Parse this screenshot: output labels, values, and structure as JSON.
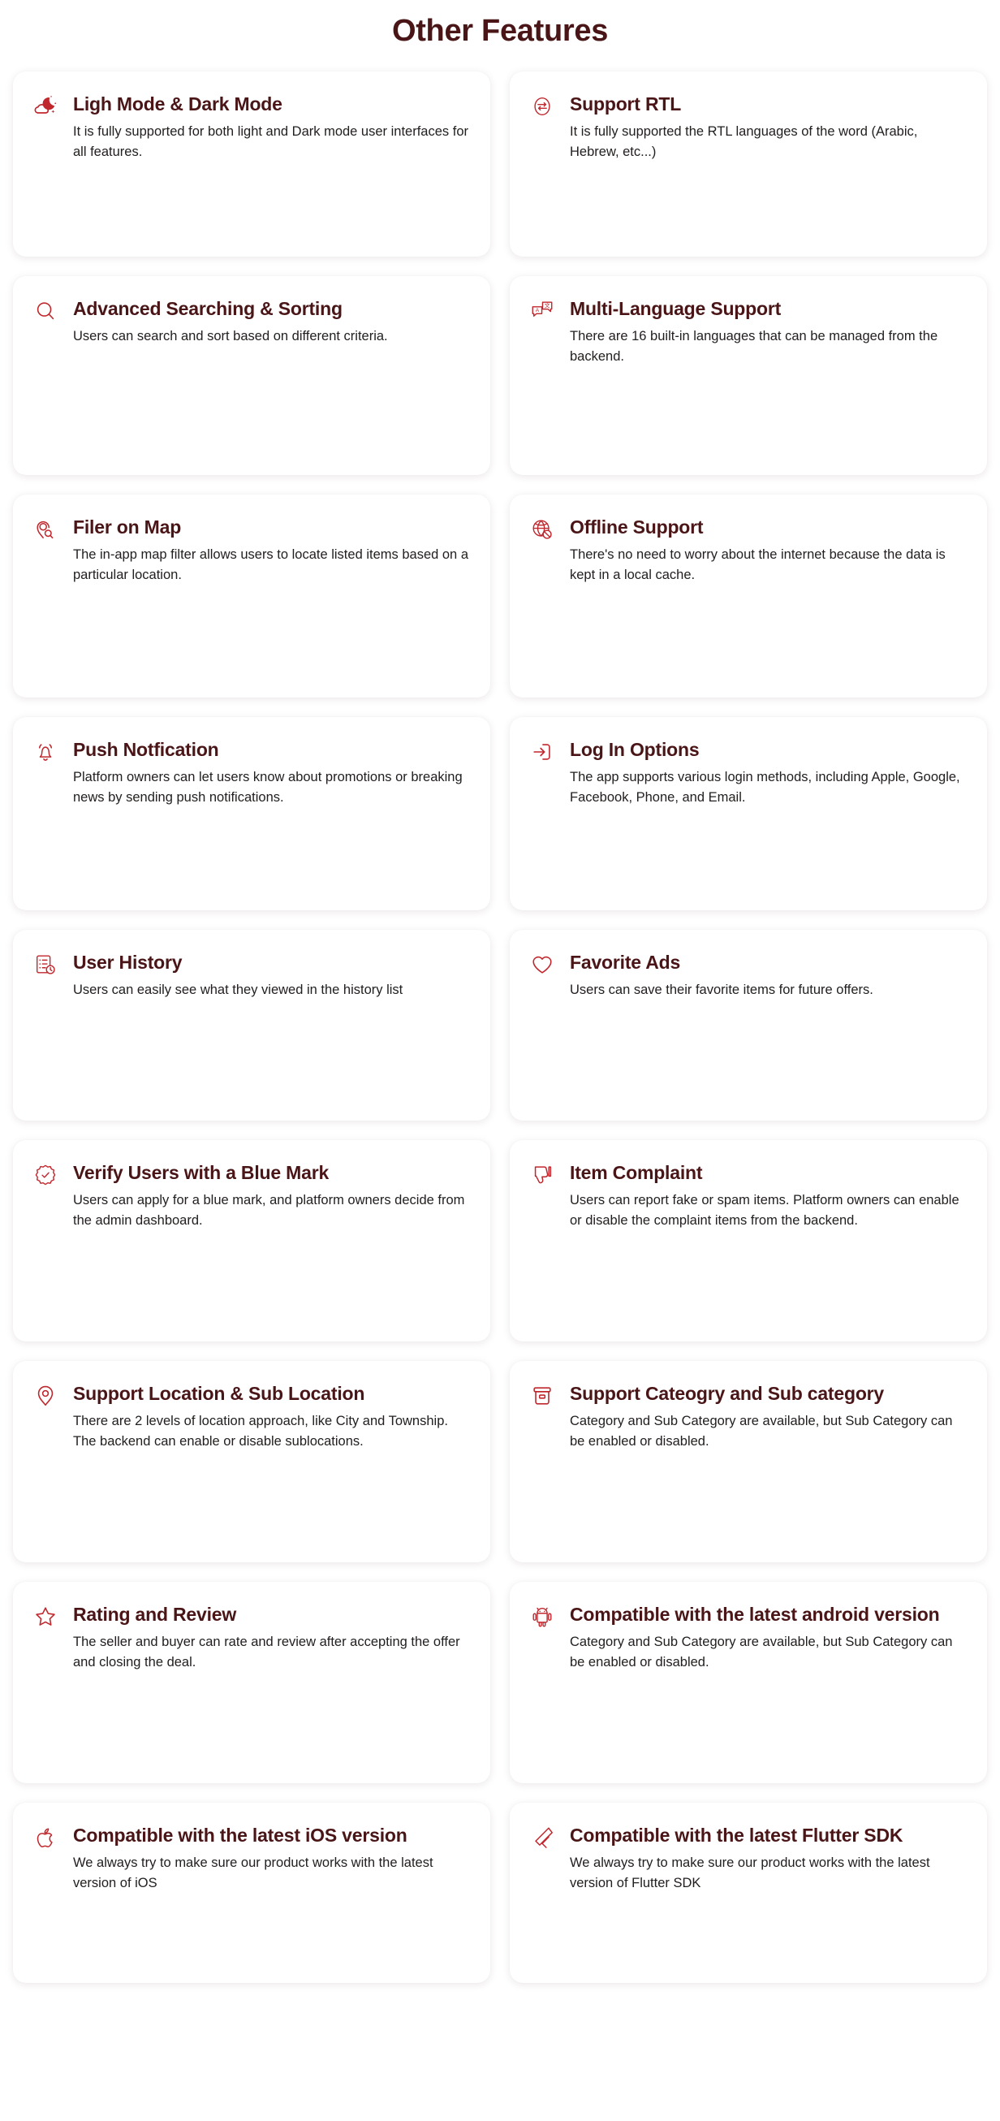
{
  "header": {
    "title": "Other Features"
  },
  "colors": {
    "title": "#4a1517",
    "icon": "#c0272d",
    "body_text": "#23201f",
    "card_bg": "#ffffff",
    "page_bg": "#ffffff"
  },
  "features": [
    {
      "icon": "moon-cloud-stars-icon",
      "title": "Ligh Mode & Dark Mode",
      "desc": "It is fully supported for both light and Dark mode user interfaces for all features."
    },
    {
      "icon": "rtl-swap-arrows-circle-icon",
      "title": "Support RTL",
      "desc": "It is fully supported the RTL languages of the word (Arabic, Hebrew, etc...)"
    },
    {
      "icon": "search-icon",
      "title": "Advanced Searching & Sorting",
      "desc": "Users can search and sort based on different criteria."
    },
    {
      "icon": "translate-icon",
      "title": "Multi-Language Support",
      "desc": "There are 16 built-in languages that can be managed from the backend."
    },
    {
      "icon": "map-pin-search-icon",
      "title": "Filer on Map",
      "desc": "The in-app map filter allows users to locate listed items based on a particular location."
    },
    {
      "icon": "globe-offline-icon",
      "title": "Offline Support",
      "desc": "There's no need to worry about the internet because the data is kept in a local cache."
    },
    {
      "icon": "bell-ring-icon",
      "title": "Push Notfication",
      "desc": "Platform owners can let users know about promotions or breaking news by sending push notifications."
    },
    {
      "icon": "login-arrow-icon",
      "title": "Log In Options",
      "desc": "The app supports various login methods, including Apple, Google, Facebook, Phone, and Email."
    },
    {
      "icon": "list-clock-history-icon",
      "title": "User History",
      "desc": "Users can easily see what they viewed in the history list"
    },
    {
      "icon": "heart-icon",
      "title": "Favorite Ads",
      "desc": "Users can save their favorite items for future offers."
    },
    {
      "icon": "verified-badge-check-icon",
      "title": "Verify Users with a Blue Mark",
      "desc": "Users can apply for a blue mark, and platform owners decide from the admin dashboard."
    },
    {
      "icon": "thumbs-down-icon",
      "title": "Item Complaint",
      "desc": "Users can report fake or spam items. Platform owners can enable or disable the complaint items from the backend."
    },
    {
      "icon": "location-pin-icon",
      "title": "Support Location & Sub Location",
      "desc": "There are 2 levels of location approach, like City and Township. The backend can enable or disable sublocations."
    },
    {
      "icon": "archive-box-icon",
      "title": "Support Cateogry and Sub category",
      "desc": "Category and Sub Category are available, but Sub Category can be enabled or disabled."
    },
    {
      "icon": "star-icon",
      "title": "Rating and Review",
      "desc": "The seller and buyer can rate and review after accepting the offer and closing the deal."
    },
    {
      "icon": "android-robot-icon",
      "title": "Compatible with the latest android version",
      "desc": "Category and Sub Category are available, but Sub Category can be enabled or disabled."
    },
    {
      "icon": "apple-logo-icon",
      "title": "Compatible with the latest iOS version",
      "desc": "We always try to make sure our product works with the latest version of iOS"
    },
    {
      "icon": "flutter-logo-icon",
      "title": "Compatible with the latest Flutter SDK",
      "desc": "We always try to make sure our product works with the latest version of Flutter SDK"
    }
  ]
}
